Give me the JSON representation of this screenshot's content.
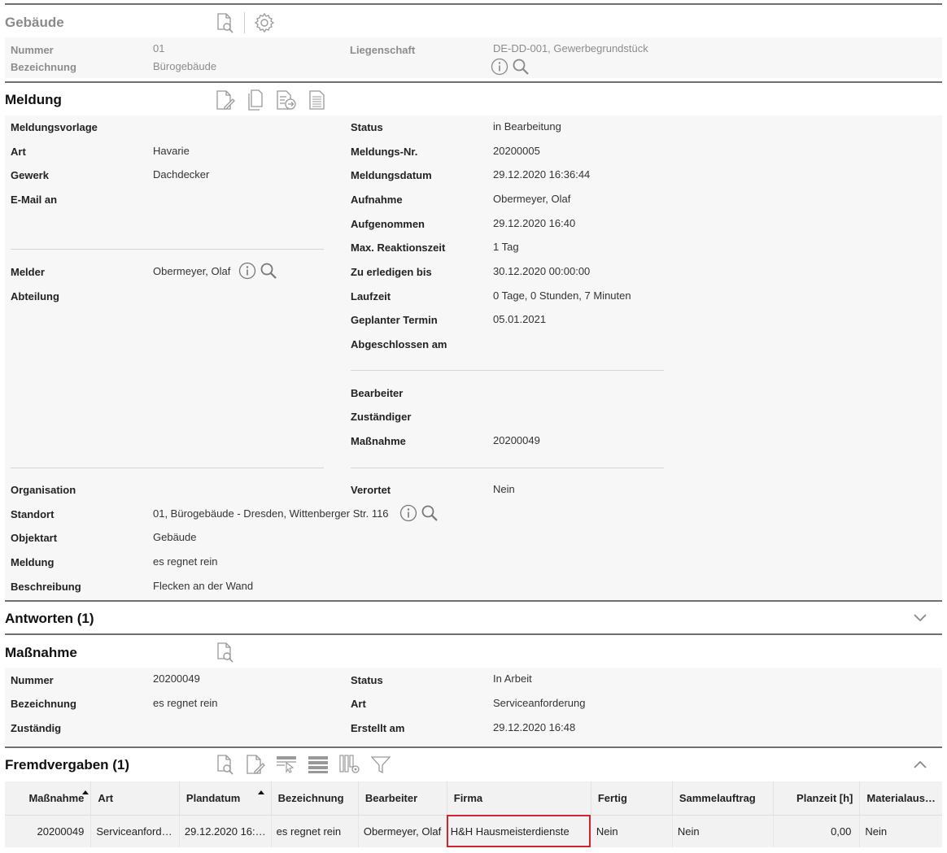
{
  "gebaeude": {
    "title": "Gebäude",
    "nummer_label": "Nummer",
    "nummer_value": "01",
    "bezeichnung_label": "Bezeichnung",
    "bezeichnung_value": "Bürogebäude",
    "liegenschaft_label": "Liegenschaft",
    "liegenschaft_value": "DE-DD-001, Gewerbegrundstück"
  },
  "meldung": {
    "title": "Meldung",
    "left": {
      "meldungsvorlage": "Meldungsvorlage",
      "art_label": "Art",
      "art_value": "Havarie",
      "gewerk_label": "Gewerk",
      "gewerk_value": "Dachdecker",
      "email_label": "E-Mail an",
      "melder_label": "Melder",
      "melder_value": "Obermeyer, Olaf",
      "abteilung_label": "Abteilung",
      "organisation_label": "Organisation",
      "standort_label": "Standort",
      "standort_value": "01, Bürogebäude - Dresden, Wittenberger Str. 116",
      "objektart_label": "Objektart",
      "objektart_value": "Gebäude",
      "meldung_label": "Meldung",
      "meldung_value": "es regnet rein",
      "beschreibung_label": "Beschreibung",
      "beschreibung_value": "Flecken an der Wand"
    },
    "right": {
      "status_label": "Status",
      "status_value": "in Bearbeitung",
      "nr_label": "Meldungs-Nr.",
      "nr_value": "20200005",
      "datum_label": "Meldungsdatum",
      "datum_value": "29.12.2020 16:36:44",
      "aufnahme_label": "Aufnahme",
      "aufnahme_value": "Obermeyer, Olaf",
      "aufgenommen_label": "Aufgenommen",
      "aufgenommen_value": "29.12.2020 16:40",
      "reaktion_label": "Max. Reaktionszeit",
      "reaktion_value": "1 Tag",
      "erledigen_label": "Zu erledigen bis",
      "erledigen_value": "30.12.2020 00:00:00",
      "laufzeit_label": "Laufzeit",
      "laufzeit_value": "0 Tage, 0 Stunden, 7 Minuten",
      "termin_label": "Geplanter Termin",
      "termin_value": "05.01.2021",
      "abgeschlossen_label": "Abgeschlossen am",
      "bearbeiter_label": "Bearbeiter",
      "zustaendiger_label": "Zuständiger",
      "massnahme_label": "Maßnahme",
      "massnahme_value": "20200049",
      "verortet_label": "Verortet",
      "verortet_value": "Nein"
    }
  },
  "antworten": {
    "title": "Antworten (1)"
  },
  "massnahme": {
    "title": "Maßnahme",
    "nummer_label": "Nummer",
    "nummer_value": "20200049",
    "bezeichnung_label": "Bezeichnung",
    "bezeichnung_value": "es regnet rein",
    "zustaendig_label": "Zuständig",
    "status_label": "Status",
    "status_value": "In Arbeit",
    "art_label": "Art",
    "art_value": "Serviceanforderung",
    "erstellt_label": "Erstellt am",
    "erstellt_value": "29.12.2020 16:48"
  },
  "fremdvergaben": {
    "title": "Fremdvergaben (1)",
    "columns": [
      "Maßnahme",
      "Art",
      "Plandatum",
      "Bezeichnung",
      "Bearbeiter",
      "Firma",
      "Fertig",
      "Sammelauftrag",
      "Planzeit [h]",
      "Materialaus…"
    ],
    "rows": [
      [
        "20200049",
        "Serviceanford…",
        "29.12.2020 16:…",
        "es regnet rein",
        "Obermeyer, Olaf",
        "H&H Hausmeisterdienste",
        "Nein",
        "Nein",
        "0,00",
        "Nein"
      ]
    ]
  }
}
